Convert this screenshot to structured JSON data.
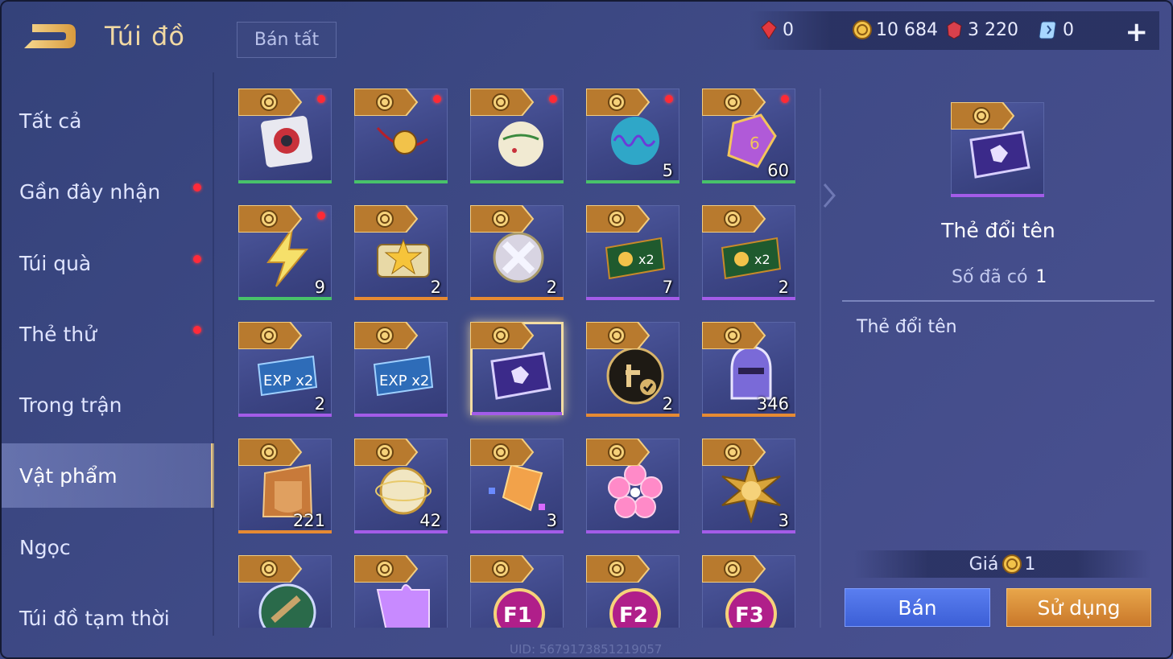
{
  "header": {
    "title": "Túi đồ",
    "sell_all": "Bán tất"
  },
  "currencies": [
    {
      "icon": "red-gem-icon",
      "value": "0"
    },
    {
      "icon": "gold-coin-icon",
      "value": "10 684"
    },
    {
      "icon": "ruby-icon",
      "value": "3 220"
    },
    {
      "icon": "voucher-icon",
      "value": "0"
    }
  ],
  "sidebar": {
    "items": [
      {
        "label": "Tất cả",
        "dot": false
      },
      {
        "label": "Gần đây nhận",
        "dot": true
      },
      {
        "label": "Túi quà",
        "dot": true
      },
      {
        "label": "Thẻ thử",
        "dot": true
      },
      {
        "label": "Trong trận",
        "dot": false
      },
      {
        "label": "Vật phẩm",
        "dot": false,
        "active": true
      },
      {
        "label": "Ngọc",
        "dot": false
      },
      {
        "label": "Túi đồ tạm thời",
        "dot": false
      }
    ]
  },
  "items": [
    {
      "icon": "crest-card-icon",
      "qty": "",
      "dot": true,
      "rarity": "green"
    },
    {
      "icon": "pendant-icon",
      "qty": "",
      "dot": true,
      "rarity": "green"
    },
    {
      "icon": "ornament-ball-icon",
      "qty": "",
      "dot": true,
      "rarity": "green"
    },
    {
      "icon": "soundwave-orb-icon",
      "qty": "5",
      "dot": true,
      "rarity": "green"
    },
    {
      "icon": "dice-icon",
      "qty": "60",
      "dot": true,
      "rarity": "green"
    },
    {
      "icon": "lightning-icon",
      "qty": "9",
      "dot": true,
      "rarity": "green"
    },
    {
      "icon": "star-ticket-icon",
      "qty": "2",
      "dot": false,
      "rarity": "orange"
    },
    {
      "icon": "cross-orb-icon",
      "qty": "2",
      "dot": false,
      "rarity": "orange"
    },
    {
      "icon": "gold-x2-card-icon",
      "qty": "7",
      "dot": false,
      "rarity": "purple"
    },
    {
      "icon": "gold-x2-card-icon",
      "qty": "2",
      "dot": false,
      "rarity": "purple"
    },
    {
      "icon": "exp-x2-card-icon",
      "qty": "2",
      "dot": false,
      "rarity": "purple"
    },
    {
      "icon": "exp-x2-card-icon",
      "qty": "",
      "dot": false,
      "rarity": "purple"
    },
    {
      "icon": "rename-card-icon",
      "qty": "",
      "dot": false,
      "rarity": "purple",
      "selected": true
    },
    {
      "icon": "tap-check-icon",
      "qty": "2",
      "dot": false,
      "rarity": "orange"
    },
    {
      "icon": "helmet-icon",
      "qty": "346",
      "dot": false,
      "rarity": "orange"
    },
    {
      "icon": "armor-chest-icon",
      "qty": "221",
      "dot": false,
      "rarity": "orange"
    },
    {
      "icon": "golden-orb-icon",
      "qty": "42",
      "dot": false,
      "rarity": "purple"
    },
    {
      "icon": "crystal-shard-icon",
      "qty": "3",
      "dot": false,
      "rarity": "purple"
    },
    {
      "icon": "sakura-icon",
      "qty": "",
      "dot": false,
      "rarity": "purple"
    },
    {
      "icon": "sun-emblem-icon",
      "qty": "3",
      "dot": false,
      "rarity": "purple"
    },
    {
      "icon": "hammer-medal-icon",
      "qty": "",
      "dot": false,
      "rarity": "none"
    },
    {
      "icon": "puzzle-piece-icon",
      "qty": "",
      "dot": false,
      "rarity": "none"
    },
    {
      "icon": "f1-badge-icon",
      "qty": "",
      "dot": false,
      "rarity": "none"
    },
    {
      "icon": "f2-badge-icon",
      "qty": "",
      "dot": false,
      "rarity": "none"
    },
    {
      "icon": "f3-badge-icon",
      "qty": "",
      "dot": false,
      "rarity": "none"
    }
  ],
  "detail": {
    "name": "Thẻ đổi tên",
    "owned_label": "Số đã có",
    "owned_value": "1",
    "description": "Thẻ đổi tên",
    "price_label": "Giá",
    "price_value": "1",
    "sell_button": "Bán",
    "use_button": "Sử dụng"
  },
  "footer": {
    "uid": "UID: 5679173851219057"
  },
  "colors": {
    "accent_gold": "#f1d9a3",
    "green": "#48c26a",
    "orange": "#e68a33",
    "purple": "#a35ce8",
    "badge": "#ff2a3a"
  }
}
